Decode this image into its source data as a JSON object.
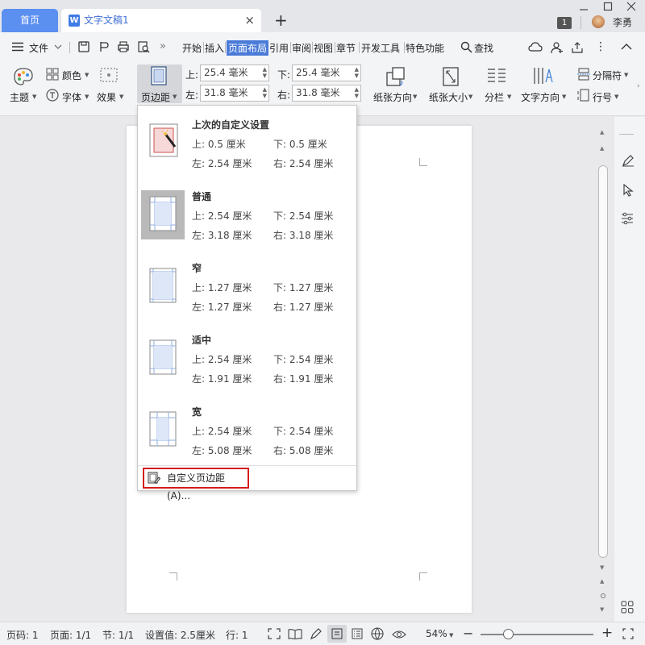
{
  "titlebar": {
    "home_tab": "首页",
    "doc_tab": "文字文稿1",
    "doc_icon": "W",
    "close": "×",
    "add": "+",
    "badge": "1",
    "user": "李勇"
  },
  "menu": {
    "file": "文件",
    "items": [
      "开始",
      "插入",
      "页面布局",
      "引用",
      "审阅",
      "视图",
      "章节",
      "开发工具",
      "特色功能"
    ],
    "search": "查找"
  },
  "ribbon": {
    "theme": "主题",
    "colors": "颜色",
    "fonts": "字体",
    "effects": "效果",
    "margins": "页边距",
    "top_label": "上:",
    "top_value": "25.4 毫米",
    "bottom_label": "下:",
    "bottom_value": "25.4 毫米",
    "left_label": "左:",
    "left_value": "31.8 毫米",
    "right_label": "右:",
    "right_value": "31.8 毫米",
    "orientation": "纸张方向",
    "size": "纸张大小",
    "columns": "分栏",
    "text_direction": "文字方向",
    "breaks": "分隔符",
    "line_numbers": "行号"
  },
  "margins_menu": {
    "options": [
      {
        "name": "上次的自定义设置",
        "top": "上: 0.5 厘米",
        "bottom": "下: 0.5 厘米",
        "left": "左: 2.54 厘米",
        "right": "右: 2.54 厘米"
      },
      {
        "name": "普通",
        "top": "上: 2.54 厘米",
        "bottom": "下: 2.54 厘米",
        "left": "左: 3.18 厘米",
        "right": "右: 3.18 厘米"
      },
      {
        "name": "窄",
        "top": "上: 1.27 厘米",
        "bottom": "下: 1.27 厘米",
        "left": "左: 1.27 厘米",
        "right": "右: 1.27 厘米"
      },
      {
        "name": "适中",
        "top": "上: 2.54 厘米",
        "bottom": "下: 2.54 厘米",
        "left": "左: 1.91 厘米",
        "right": "右: 1.91 厘米"
      },
      {
        "name": "宽",
        "top": "上: 2.54 厘米",
        "bottom": "下: 2.54 厘米",
        "left": "左: 5.08 厘米",
        "right": "右: 5.08 厘米"
      }
    ],
    "custom": "自定义页边距(A)..."
  },
  "status": {
    "page_num": "页码: 1",
    "pages": "页面: 1/1",
    "section": "节: 1/1",
    "setting": "设置值: 2.5厘米",
    "row": "行: 1",
    "zoom": "54%",
    "zoom_minus": "−",
    "zoom_plus": "+"
  },
  "colors": {
    "accent": "#4a7bd8",
    "home_tab": "#5b8ff0",
    "highlight_border": "#d61c1c"
  }
}
